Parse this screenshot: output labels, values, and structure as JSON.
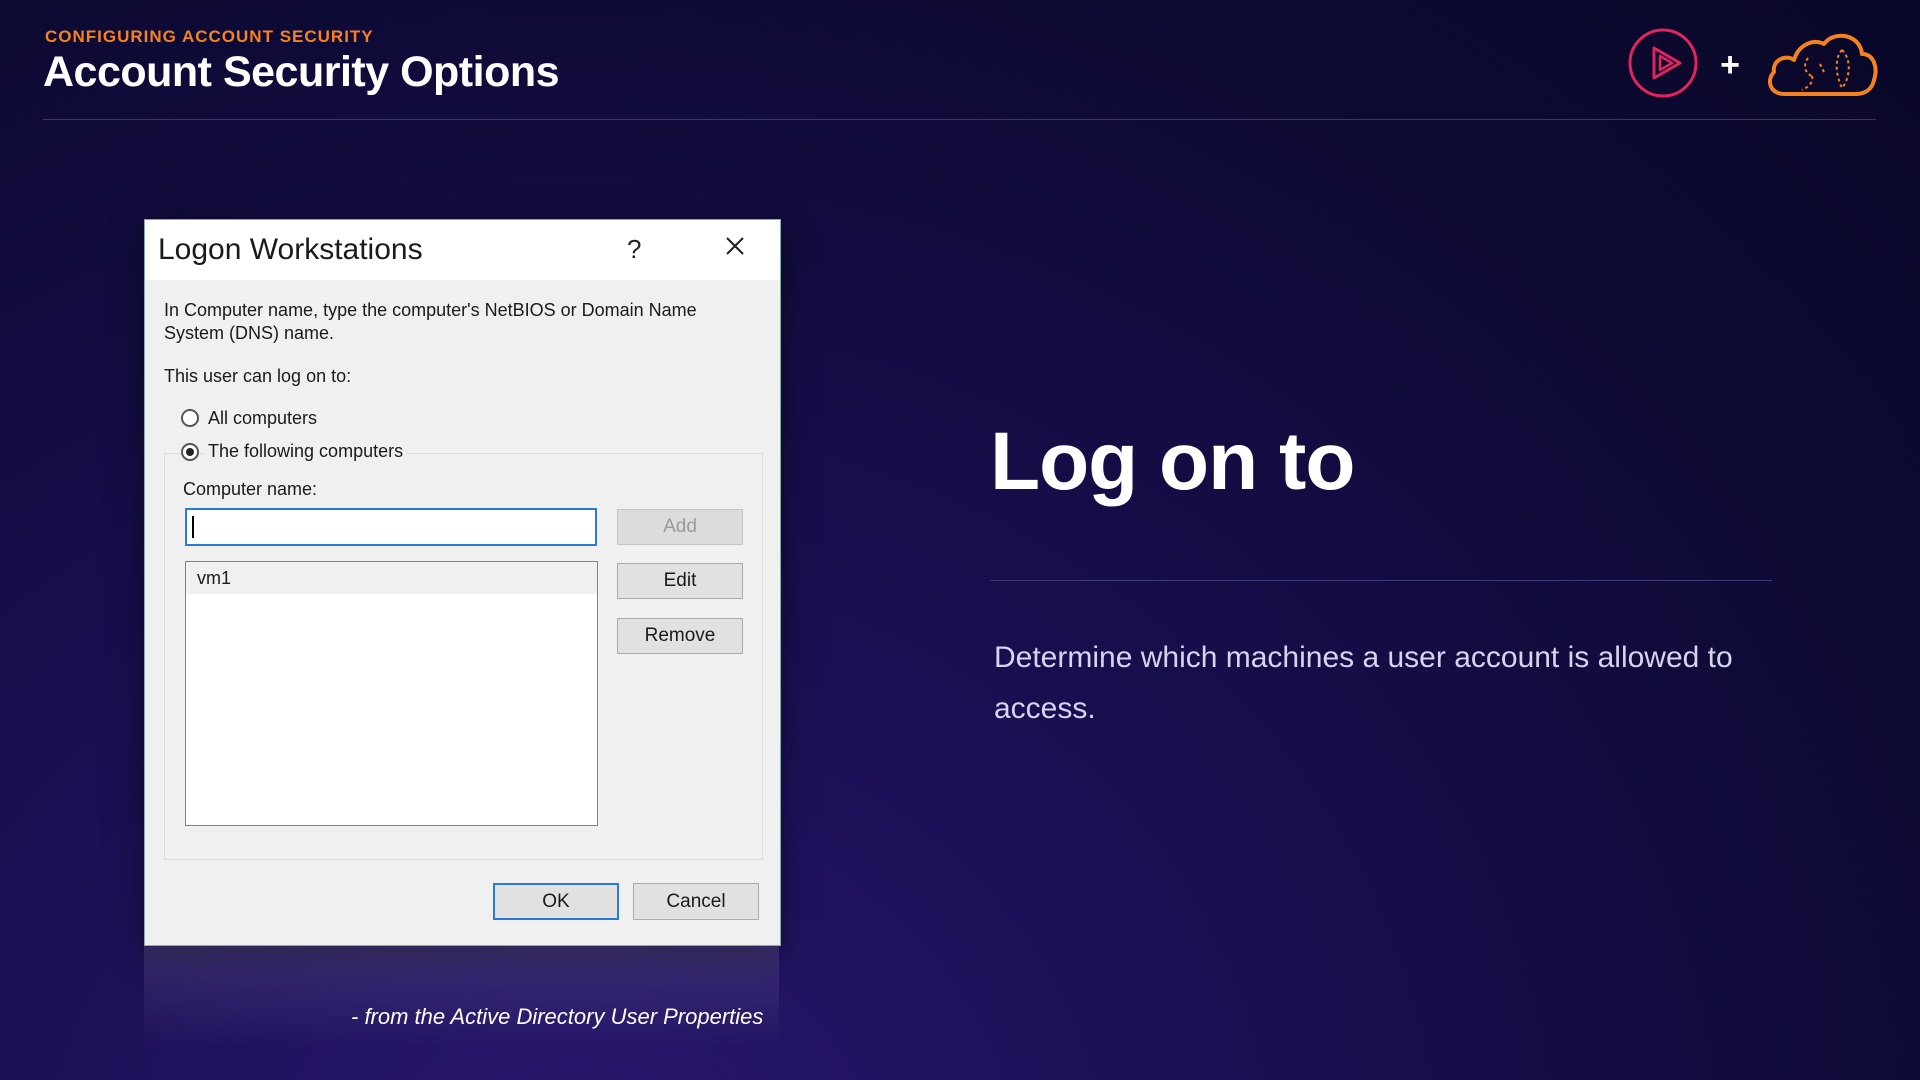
{
  "header": {
    "eyebrow": "CONFIGURING ACCOUNT SECURITY",
    "title": "Account Security Options",
    "plus": "+"
  },
  "dialog": {
    "title": "Logon Workstations",
    "help": "?",
    "instruction_line1": "In Computer name, type the computer's NetBIOS or Domain Name",
    "instruction_line2": "System (DNS) name.",
    "logon_label": "This user can log on to:",
    "radio_all": "All computers",
    "radio_following": "The following computers",
    "selected_option": "The following computers",
    "computer_name_label": "Computer name:",
    "computer_name_value": "",
    "list_items": [
      "vm1"
    ],
    "add_label": "Add",
    "edit_label": "Edit",
    "remove_label": "Remove",
    "ok_label": "OK",
    "cancel_label": "Cancel"
  },
  "caption": "- from the Active Directory User Properties",
  "content": {
    "title": "Log on to",
    "description": "Determine which machines a user account is allowed to access."
  },
  "colors": {
    "accent_orange": "#f58220",
    "logo_red": "#e0245e",
    "focus_blue": "#2b7ad6"
  },
  "icons": [
    "play-logo-icon",
    "cloud-logo-icon",
    "close-icon"
  ]
}
